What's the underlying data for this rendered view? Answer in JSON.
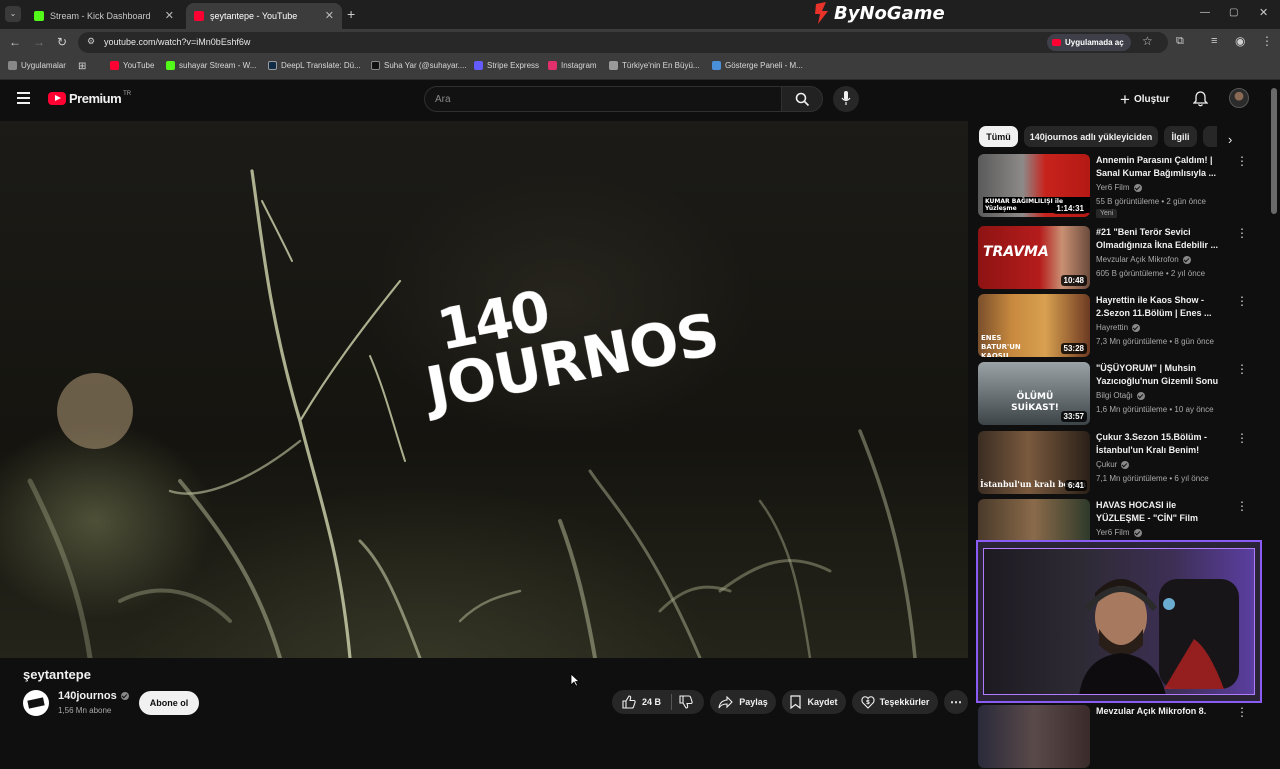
{
  "browser": {
    "tabs": [
      {
        "title": "Stream - Kick Dashboard",
        "favicon_color": "#53fc18"
      },
      {
        "title": "şeytantepe - YouTube",
        "favicon_color": "#ff0033"
      }
    ],
    "new_tab_glyph": "+",
    "banner": "ByNoGame",
    "url": "youtube.com/watch?v=iMn0bEshf6w",
    "open_in_app": "Uygulamada aç",
    "bookmarks": [
      {
        "label": "Uygulamalar",
        "icon": "apps-grid-icon",
        "color": "#888888"
      },
      {
        "label": "YouTube",
        "icon": "youtube-icon",
        "color": "#ff0033"
      },
      {
        "label": "suhayar Stream - W...",
        "icon": "kick-icon",
        "color": "#53fc18"
      },
      {
        "label": "DeepL Translate: Dü...",
        "icon": "deepl-icon",
        "color": "#0f2b46"
      },
      {
        "label": "Suha Yar (@suhayar....",
        "icon": "tiktok-icon",
        "color": "#111111"
      },
      {
        "label": "Stripe Express",
        "icon": "stripe-icon",
        "color": "#635bff"
      },
      {
        "label": "Instagram",
        "icon": "instagram-icon",
        "color": "#e1306c"
      },
      {
        "label": "Türkiye'nin En Büyü...",
        "icon": "bird-icon",
        "color": "#9a9a9a"
      },
      {
        "label": "Gösterge Paneli - M...",
        "icon": "dashboard-icon",
        "color": "#4a90d9"
      }
    ]
  },
  "youtube": {
    "brand": "Premium",
    "region": "TR",
    "search_placeholder": "Ara",
    "create_label": "Oluştur",
    "video": {
      "logo_line1": "140",
      "logo_line2": "JOURNOS",
      "title": "şeytantepe",
      "channel": "140journos",
      "subscribers": "1,56 Mn abone",
      "subscribe_label": "Abone ol",
      "likes": "24 B",
      "share_label": "Paylaş",
      "save_label": "Kaydet",
      "thanks_label": "Teşekkürler"
    },
    "chips": [
      "Tümü",
      "140journos adlı yükleyiciden",
      "İlgili"
    ],
    "recommendations": [
      {
        "title": "Annemin Parasını Çaldım! | Sanal Kumar Bağımlısıyla ...",
        "channel": "Yer6 Film",
        "meta": "55 B görüntüleme • 2 gün önce",
        "duration": "1:14:31",
        "badge": "Yeni",
        "thumb_text": "KUMAR BAĞIMLILIŞI ile Yüzleşme"
      },
      {
        "title": "#21 \"Beni Terör Sevici Olmadığınıza İkna Edebilir ...",
        "channel": "Mevzular Açık Mikrofon",
        "meta": "605 B görüntüleme • 2 yıl önce",
        "duration": "10:48",
        "thumb_text": "TRAVMA"
      },
      {
        "title": "Hayrettin ile Kaos Show - 2.Sezon 11.Bölüm | Enes ...",
        "channel": "Hayrettin",
        "meta": "7,3 Mn görüntüleme • 8 gün önce",
        "duration": "53:28",
        "thumb_text": "ENES BATUR'UN KAOSU"
      },
      {
        "title": "\"ÜŞÜYORUM\" | Muhsin Yazıcıoğlu'nun Gizemli Sonu",
        "channel": "Bilgi Otağı",
        "meta": "1,6 Mn görüntüleme • 10 ay önce",
        "duration": "33:57",
        "thumb_text": "ÖLÜMÜ SUİKAST!"
      },
      {
        "title": "Çukur 3.Sezon 15.Bölüm - İstanbul'un Kralı Benim!",
        "channel": "Çukur",
        "meta": "7,1 Mn görüntüleme • 6 yıl önce",
        "duration": "6:41",
        "thumb_text": "İstanbul'un kralı benim"
      },
      {
        "title": "HAVAS HOCASI ile YÜZLEŞME - \"CİN\" Film Sahnelerini ...",
        "channel": "Yer6 Film",
        "meta": "",
        "duration": "",
        "thumb_text": ""
      },
      {
        "title": "Mevzular Açık Mikrofon 8.",
        "channel": "",
        "meta": "",
        "duration": "",
        "thumb_text": ""
      }
    ]
  },
  "colors": {
    "accent_red": "#ff0033",
    "webcam_border": "#8a5cf5",
    "bg": "#0f0f0f"
  }
}
